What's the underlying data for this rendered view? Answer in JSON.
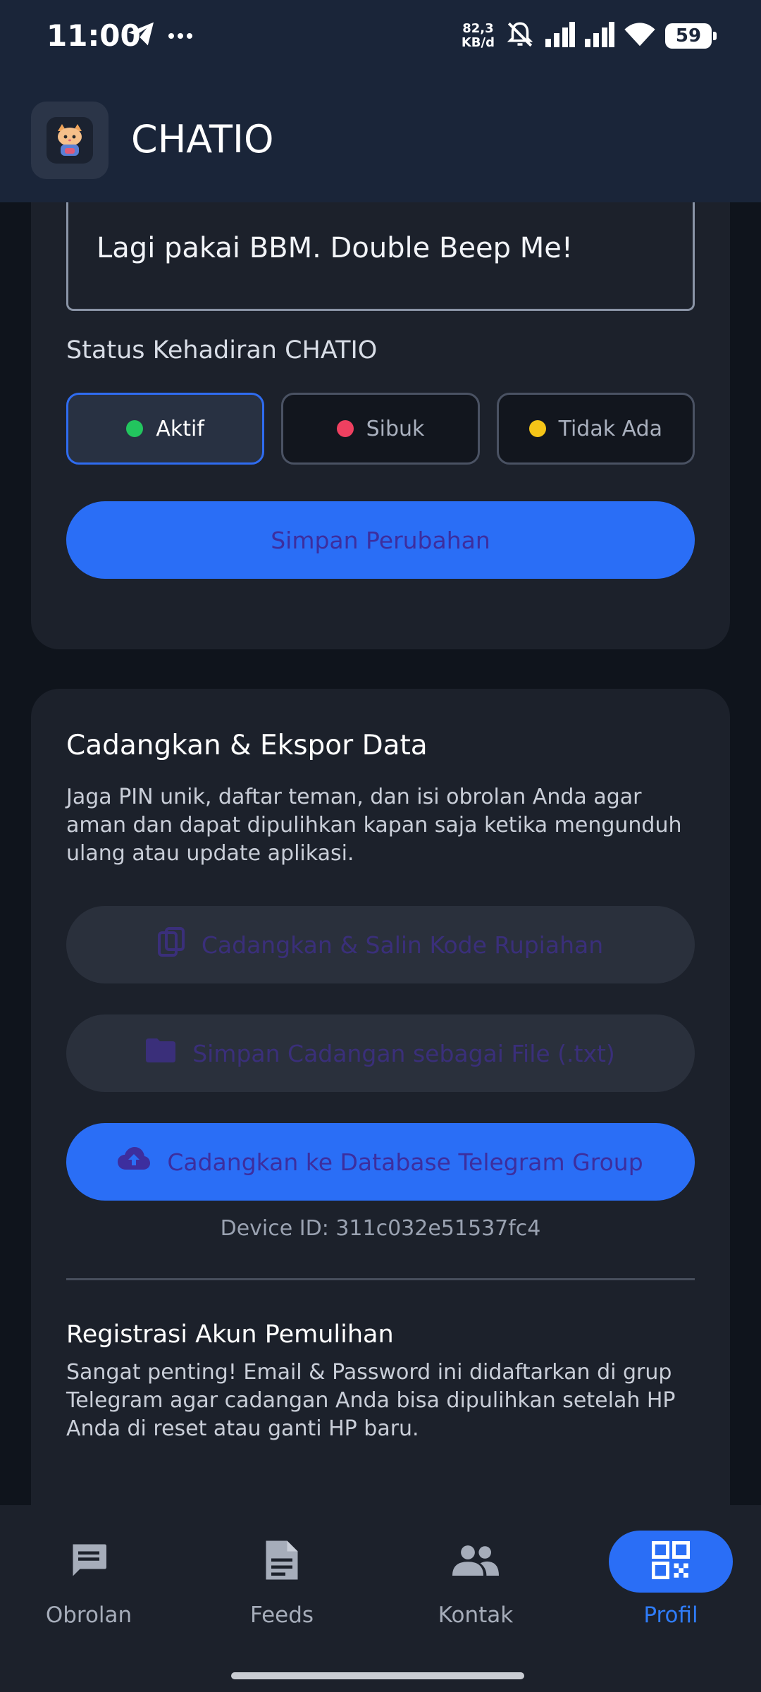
{
  "status_bar": {
    "time": "11:00",
    "net_speed_value": "82,3",
    "net_speed_unit": "KB/d",
    "battery": "59",
    "icons": [
      "telegram-icon",
      "more-dots-icon",
      "mute-icon",
      "signal-icon",
      "signal-icon",
      "wifi-icon",
      "battery-icon"
    ]
  },
  "app_bar": {
    "title": "CHATIO",
    "logo_icon": "cat-avatar-icon"
  },
  "profile_card": {
    "status_message_value": "Lagi pakai BBM. Double Beep Me!",
    "presence_label": "Status Kehadiran CHATIO",
    "presence_options": [
      {
        "label": "Aktif",
        "color": "#22c55e",
        "selected": true
      },
      {
        "label": "Sibuk",
        "color": "#ef4060",
        "selected": false
      },
      {
        "label": "Tidak Ada",
        "color": "#f5c518",
        "selected": false
      }
    ],
    "save_label": "Simpan Perubahan"
  },
  "backup_card": {
    "title": "Cadangkan & Ekspor Data",
    "description": "Jaga PIN unik, daftar teman, dan isi obrolan Anda agar aman dan dapat dipulihkan kapan saja ketika mengunduh ulang atau update aplikasi.",
    "copy_button_label": "Cadangkan & Salin Kode Rupiahan",
    "file_button_label": "Simpan Cadangan sebagai File (.txt)",
    "telegram_button_label": "Cadangkan ke Database Telegram Group",
    "device_id": "Device ID: 311c032e51537fc4",
    "registration_title": "Registrasi Akun Pemulihan",
    "registration_description": "Sangat penting! Email & Password ini didaftarkan di grup Telegram agar cadangan Anda bisa dipulihkan setelah HP Anda di reset atau ganti HP baru."
  },
  "bottom_nav": {
    "items": [
      {
        "label": "Obrolan",
        "icon": "chat-icon",
        "active": false
      },
      {
        "label": "Feeds",
        "icon": "document-icon",
        "active": false
      },
      {
        "label": "Kontak",
        "icon": "people-icon",
        "active": false
      },
      {
        "label": "Profil",
        "icon": "qr-code-icon",
        "active": true
      }
    ]
  },
  "colors": {
    "accent": "#2a6ef6",
    "app_bar": "#1a2539",
    "card": "#1c212b",
    "background": "#0f141c"
  }
}
